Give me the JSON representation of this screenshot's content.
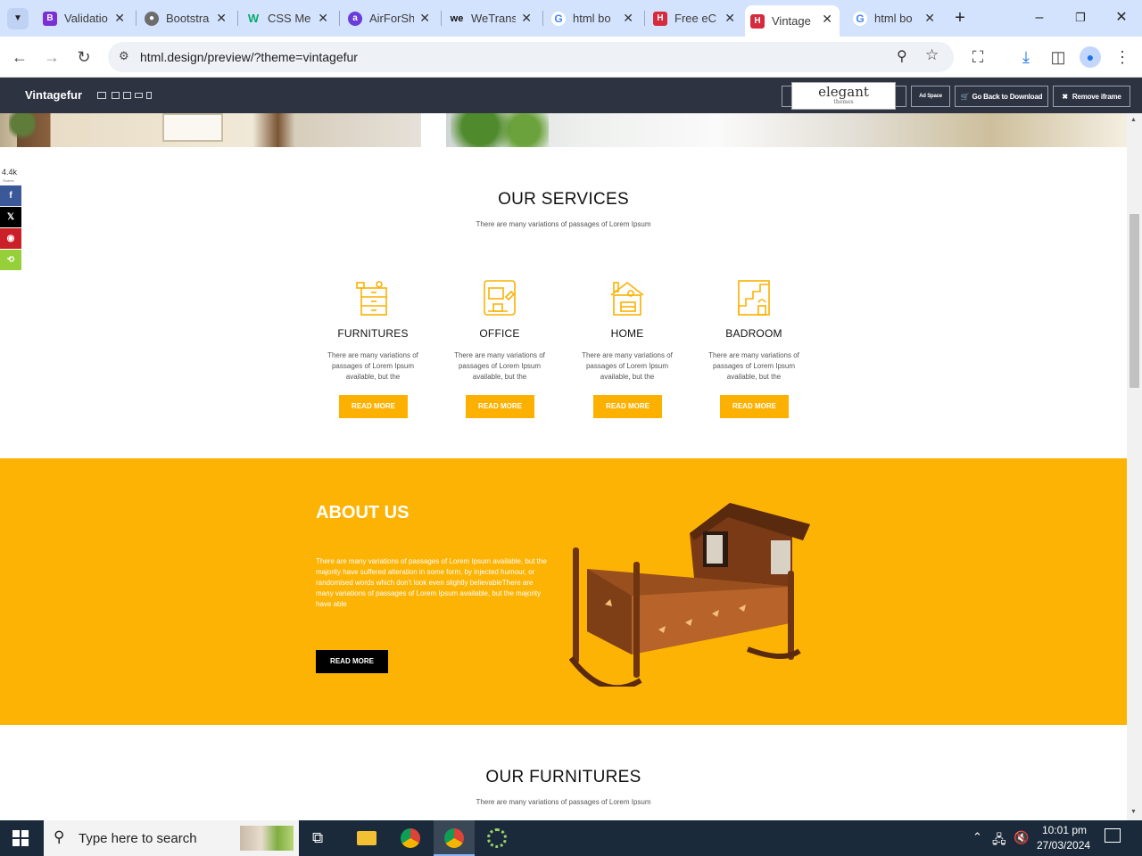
{
  "browser": {
    "tabs": [
      {
        "title": "Validatio",
        "favicon": "B"
      },
      {
        "title": "Bootstra",
        "favicon": "globe"
      },
      {
        "title": "CSS Me",
        "favicon": "W"
      },
      {
        "title": "AirForSh",
        "favicon": "a"
      },
      {
        "title": "WeTrans",
        "favicon": "we"
      },
      {
        "title": "html bo",
        "favicon": "G"
      },
      {
        "title": "Free eC",
        "favicon": "H"
      },
      {
        "title": "Vintage",
        "favicon": "H"
      },
      {
        "title": "html bo",
        "favicon": "G"
      }
    ],
    "url": "html.design/preview/?theme=vintagefur"
  },
  "preview_bar": {
    "brand": "Vintagefur",
    "ad_logo": "elegant",
    "ad_logo_sub": "themes",
    "ad_space": "Ad Space",
    "back_to_download": "Go Back to Download",
    "remove_iframe": "Remove iframe"
  },
  "share": {
    "count": "4.4k",
    "label": "Shares"
  },
  "services": {
    "title": "OUR SERVICES",
    "subtitle": "There are many variations of passages of Lorem Ipsum",
    "items": [
      {
        "name": "FURNITURES",
        "desc": "There are many variations of passages of Lorem Ipsum available, but the",
        "button": "READ MORE"
      },
      {
        "name": "OFFICE",
        "desc": "There are many variations of passages of Lorem Ipsum available, but the",
        "button": "READ MORE"
      },
      {
        "name": "HOME",
        "desc": "There are many variations of passages of Lorem Ipsum available, but the",
        "button": "READ MORE"
      },
      {
        "name": "BADROOM",
        "desc": "There are many variations of passages of Lorem Ipsum available, but the",
        "button": "READ MORE"
      }
    ]
  },
  "about": {
    "title": "ABOUT US",
    "text": "There are many variations of passages of Lorem Ipsum available, but the majority have suffered alteration in some form, by injected humour, or randomised words which don't look even slightly believableThere are many variations of passages of Lorem Ipsum available, but the majority have able",
    "button": "READ MORE"
  },
  "furnitures": {
    "title": "OUR FURNITURES",
    "subtitle": "There are many variations of passages of Lorem Ipsum"
  },
  "taskbar": {
    "search_placeholder": "Type here to search",
    "time": "10:01 pm",
    "date": "27/03/2024"
  },
  "colors": {
    "accent": "#fcb100",
    "preview_bar": "#2d3341",
    "tabstrip": "#d3e3fd"
  }
}
